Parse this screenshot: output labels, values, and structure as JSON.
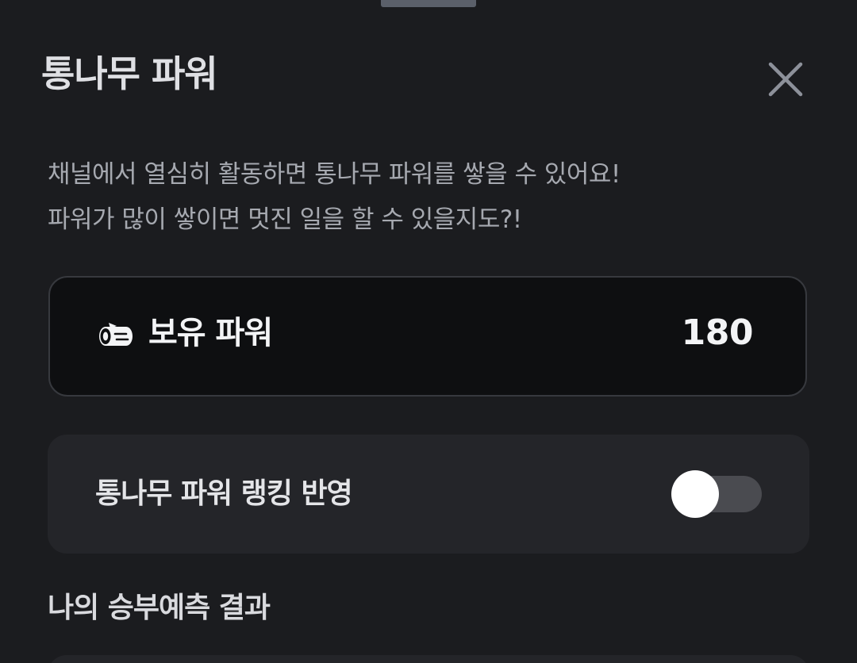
{
  "sheet": {
    "title": "통나무 파워",
    "description_line1": "채널에서 열심히 활동하면 통나무 파워를 쌓을 수 있어요!",
    "description_line2": "파워가 많이 쌓이면 멋진 일을 할 수 있을지도?!"
  },
  "power": {
    "label": "보유 파워",
    "value": "180",
    "icon": "log-icon"
  },
  "ranking": {
    "label": "통나무 파워 랭킹 반영",
    "toggle_on": false
  },
  "prediction": {
    "section_title": "나의 승부예측 결과"
  },
  "colors": {
    "background": "#1b1c1f",
    "card_dark": "#0e0f11",
    "card_gray": "#242529",
    "handle": "#5b606a",
    "toggle_track_off": "#4a4b50"
  }
}
